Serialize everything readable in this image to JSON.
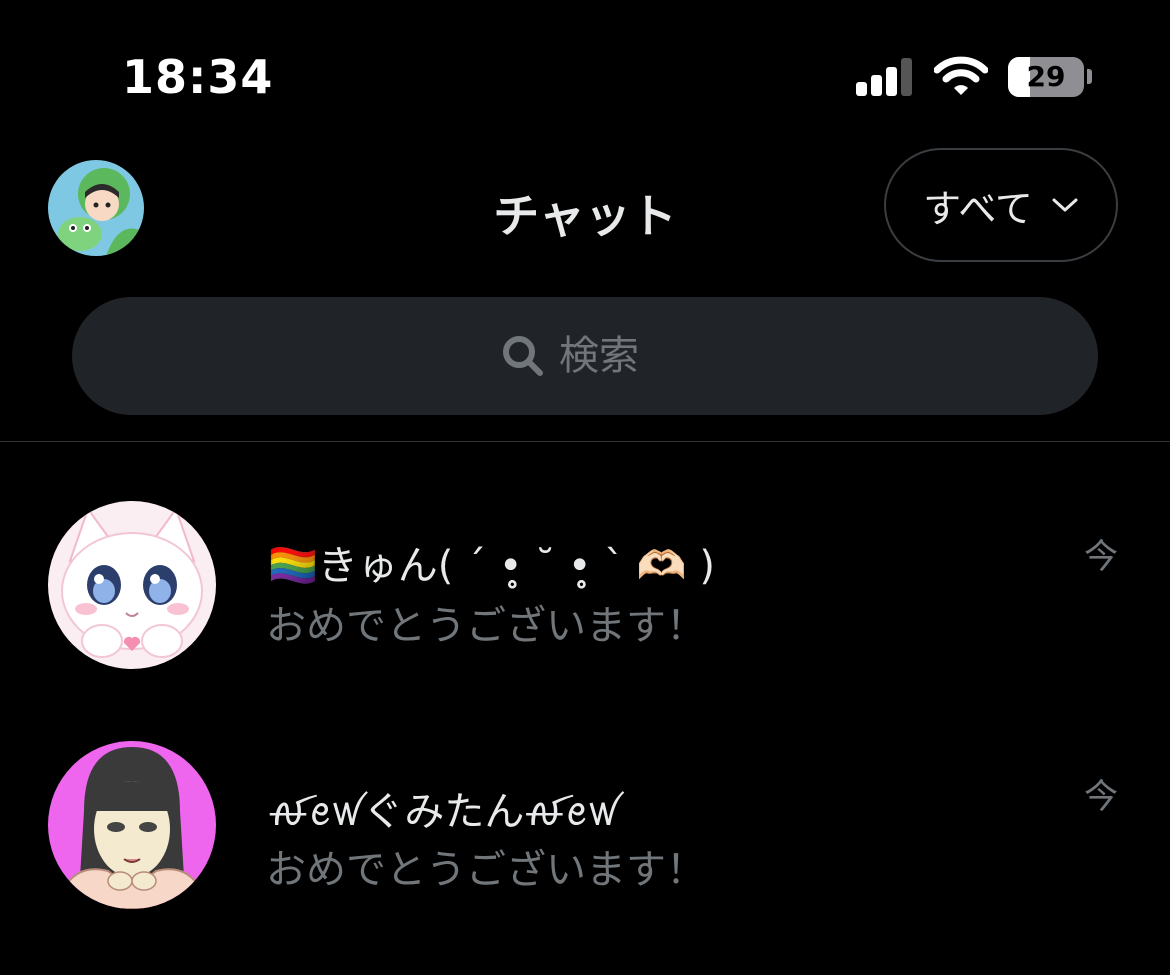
{
  "status_bar": {
    "time": "18:34",
    "battery_level": "29",
    "battery_fraction": 0.29,
    "signal_bars_active": 3,
    "signal_bars_total": 4
  },
  "header": {
    "title": "チャット",
    "filter": {
      "label": "すべて",
      "icon": "chevron-down-icon"
    },
    "profile_avatar_icon": "user-avatar"
  },
  "search": {
    "placeholder": "検索",
    "value": ""
  },
  "conversations": [
    {
      "name": "🏳️‍🌈きゅん( ´ •̥̥̥ ˘ •̥̥̥ ` 🫶🏻 )",
      "last_message": "おめでとうございます！",
      "time": "今"
    },
    {
      "name": "ꫛꫀꪝぐみたんꫛꫀꪝ",
      "last_message": "おめでとうございます！",
      "time": "今"
    }
  ],
  "colors": {
    "background": "#000000",
    "primary_text": "#e7e9ea",
    "secondary_text": "#71767b",
    "search_background": "#202327",
    "divider": "#2f3336"
  }
}
